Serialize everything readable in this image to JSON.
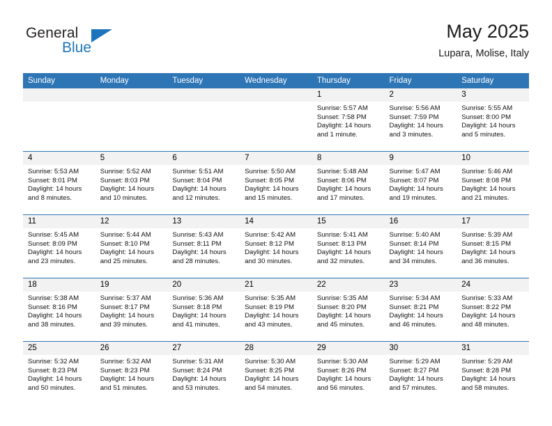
{
  "brand": {
    "line1": "General",
    "line2": "Blue",
    "triangle_color": "#1c75bc"
  },
  "header": {
    "title": "May 2025",
    "subtitle": "Lupara, Molise, Italy"
  },
  "theme": {
    "header_bar": "#2e75b6",
    "daynum_band": "#f2f2f2",
    "text": "#111111"
  },
  "weekdays": [
    "Sunday",
    "Monday",
    "Tuesday",
    "Wednesday",
    "Thursday",
    "Friday",
    "Saturday"
  ],
  "weeks": [
    [
      {
        "day": "",
        "empty": true,
        "l1": "",
        "l2": "",
        "l3": "",
        "l4": ""
      },
      {
        "day": "",
        "empty": true,
        "l1": "",
        "l2": "",
        "l3": "",
        "l4": ""
      },
      {
        "day": "",
        "empty": true,
        "l1": "",
        "l2": "",
        "l3": "",
        "l4": ""
      },
      {
        "day": "",
        "empty": true,
        "l1": "",
        "l2": "",
        "l3": "",
        "l4": ""
      },
      {
        "day": "1",
        "empty": false,
        "l1": "Sunrise: 5:57 AM",
        "l2": "Sunset: 7:58 PM",
        "l3": "Daylight: 14 hours",
        "l4": "and 1 minute."
      },
      {
        "day": "2",
        "empty": false,
        "l1": "Sunrise: 5:56 AM",
        "l2": "Sunset: 7:59 PM",
        "l3": "Daylight: 14 hours",
        "l4": "and 3 minutes."
      },
      {
        "day": "3",
        "empty": false,
        "l1": "Sunrise: 5:55 AM",
        "l2": "Sunset: 8:00 PM",
        "l3": "Daylight: 14 hours",
        "l4": "and 5 minutes."
      }
    ],
    [
      {
        "day": "4",
        "empty": false,
        "l1": "Sunrise: 5:53 AM",
        "l2": "Sunset: 8:01 PM",
        "l3": "Daylight: 14 hours",
        "l4": "and 8 minutes."
      },
      {
        "day": "5",
        "empty": false,
        "l1": "Sunrise: 5:52 AM",
        "l2": "Sunset: 8:03 PM",
        "l3": "Daylight: 14 hours",
        "l4": "and 10 minutes."
      },
      {
        "day": "6",
        "empty": false,
        "l1": "Sunrise: 5:51 AM",
        "l2": "Sunset: 8:04 PM",
        "l3": "Daylight: 14 hours",
        "l4": "and 12 minutes."
      },
      {
        "day": "7",
        "empty": false,
        "l1": "Sunrise: 5:50 AM",
        "l2": "Sunset: 8:05 PM",
        "l3": "Daylight: 14 hours",
        "l4": "and 15 minutes."
      },
      {
        "day": "8",
        "empty": false,
        "l1": "Sunrise: 5:48 AM",
        "l2": "Sunset: 8:06 PM",
        "l3": "Daylight: 14 hours",
        "l4": "and 17 minutes."
      },
      {
        "day": "9",
        "empty": false,
        "l1": "Sunrise: 5:47 AM",
        "l2": "Sunset: 8:07 PM",
        "l3": "Daylight: 14 hours",
        "l4": "and 19 minutes."
      },
      {
        "day": "10",
        "empty": false,
        "l1": "Sunrise: 5:46 AM",
        "l2": "Sunset: 8:08 PM",
        "l3": "Daylight: 14 hours",
        "l4": "and 21 minutes."
      }
    ],
    [
      {
        "day": "11",
        "empty": false,
        "l1": "Sunrise: 5:45 AM",
        "l2": "Sunset: 8:09 PM",
        "l3": "Daylight: 14 hours",
        "l4": "and 23 minutes."
      },
      {
        "day": "12",
        "empty": false,
        "l1": "Sunrise: 5:44 AM",
        "l2": "Sunset: 8:10 PM",
        "l3": "Daylight: 14 hours",
        "l4": "and 25 minutes."
      },
      {
        "day": "13",
        "empty": false,
        "l1": "Sunrise: 5:43 AM",
        "l2": "Sunset: 8:11 PM",
        "l3": "Daylight: 14 hours",
        "l4": "and 28 minutes."
      },
      {
        "day": "14",
        "empty": false,
        "l1": "Sunrise: 5:42 AM",
        "l2": "Sunset: 8:12 PM",
        "l3": "Daylight: 14 hours",
        "l4": "and 30 minutes."
      },
      {
        "day": "15",
        "empty": false,
        "l1": "Sunrise: 5:41 AM",
        "l2": "Sunset: 8:13 PM",
        "l3": "Daylight: 14 hours",
        "l4": "and 32 minutes."
      },
      {
        "day": "16",
        "empty": false,
        "l1": "Sunrise: 5:40 AM",
        "l2": "Sunset: 8:14 PM",
        "l3": "Daylight: 14 hours",
        "l4": "and 34 minutes."
      },
      {
        "day": "17",
        "empty": false,
        "l1": "Sunrise: 5:39 AM",
        "l2": "Sunset: 8:15 PM",
        "l3": "Daylight: 14 hours",
        "l4": "and 36 minutes."
      }
    ],
    [
      {
        "day": "18",
        "empty": false,
        "l1": "Sunrise: 5:38 AM",
        "l2": "Sunset: 8:16 PM",
        "l3": "Daylight: 14 hours",
        "l4": "and 38 minutes."
      },
      {
        "day": "19",
        "empty": false,
        "l1": "Sunrise: 5:37 AM",
        "l2": "Sunset: 8:17 PM",
        "l3": "Daylight: 14 hours",
        "l4": "and 39 minutes."
      },
      {
        "day": "20",
        "empty": false,
        "l1": "Sunrise: 5:36 AM",
        "l2": "Sunset: 8:18 PM",
        "l3": "Daylight: 14 hours",
        "l4": "and 41 minutes."
      },
      {
        "day": "21",
        "empty": false,
        "l1": "Sunrise: 5:35 AM",
        "l2": "Sunset: 8:19 PM",
        "l3": "Daylight: 14 hours",
        "l4": "and 43 minutes."
      },
      {
        "day": "22",
        "empty": false,
        "l1": "Sunrise: 5:35 AM",
        "l2": "Sunset: 8:20 PM",
        "l3": "Daylight: 14 hours",
        "l4": "and 45 minutes."
      },
      {
        "day": "23",
        "empty": false,
        "l1": "Sunrise: 5:34 AM",
        "l2": "Sunset: 8:21 PM",
        "l3": "Daylight: 14 hours",
        "l4": "and 46 minutes."
      },
      {
        "day": "24",
        "empty": false,
        "l1": "Sunrise: 5:33 AM",
        "l2": "Sunset: 8:22 PM",
        "l3": "Daylight: 14 hours",
        "l4": "and 48 minutes."
      }
    ],
    [
      {
        "day": "25",
        "empty": false,
        "l1": "Sunrise: 5:32 AM",
        "l2": "Sunset: 8:23 PM",
        "l3": "Daylight: 14 hours",
        "l4": "and 50 minutes."
      },
      {
        "day": "26",
        "empty": false,
        "l1": "Sunrise: 5:32 AM",
        "l2": "Sunset: 8:23 PM",
        "l3": "Daylight: 14 hours",
        "l4": "and 51 minutes."
      },
      {
        "day": "27",
        "empty": false,
        "l1": "Sunrise: 5:31 AM",
        "l2": "Sunset: 8:24 PM",
        "l3": "Daylight: 14 hours",
        "l4": "and 53 minutes."
      },
      {
        "day": "28",
        "empty": false,
        "l1": "Sunrise: 5:30 AM",
        "l2": "Sunset: 8:25 PM",
        "l3": "Daylight: 14 hours",
        "l4": "and 54 minutes."
      },
      {
        "day": "29",
        "empty": false,
        "l1": "Sunrise: 5:30 AM",
        "l2": "Sunset: 8:26 PM",
        "l3": "Daylight: 14 hours",
        "l4": "and 56 minutes."
      },
      {
        "day": "30",
        "empty": false,
        "l1": "Sunrise: 5:29 AM",
        "l2": "Sunset: 8:27 PM",
        "l3": "Daylight: 14 hours",
        "l4": "and 57 minutes."
      },
      {
        "day": "31",
        "empty": false,
        "l1": "Sunrise: 5:29 AM",
        "l2": "Sunset: 8:28 PM",
        "l3": "Daylight: 14 hours",
        "l4": "and 58 minutes."
      }
    ]
  ]
}
